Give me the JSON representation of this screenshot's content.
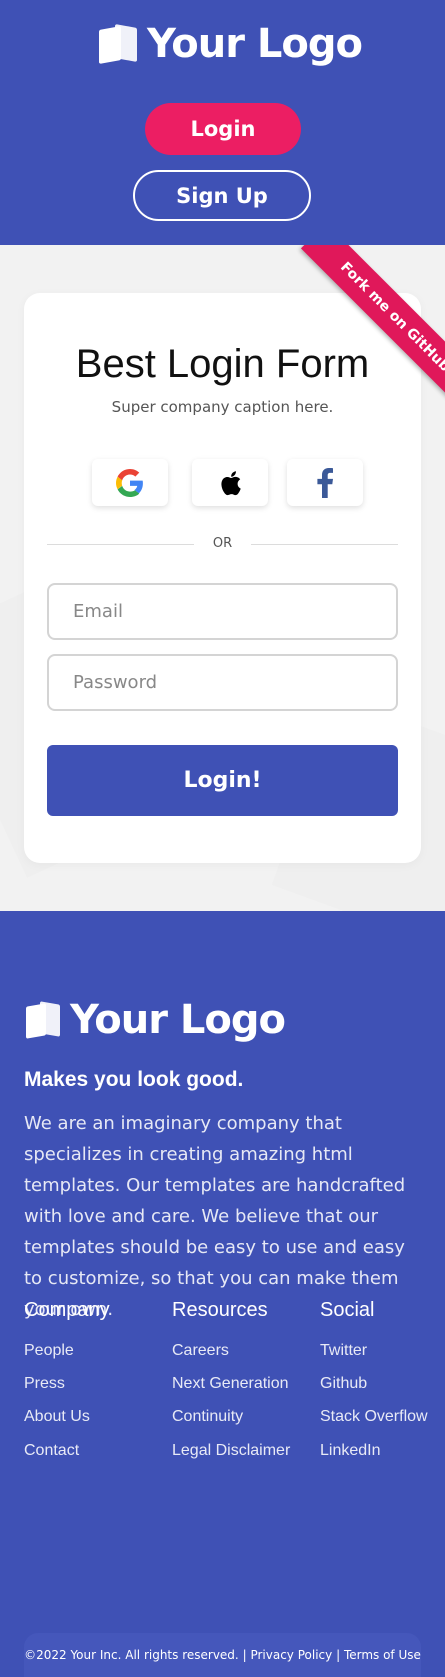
{
  "brand": {
    "logo_text": "Your Logo",
    "primary_color": "#3f51b5",
    "accent_color": "#ec1e63"
  },
  "header": {
    "login_label": "Login",
    "signup_label": "Sign Up"
  },
  "ribbon": {
    "label": "Fork me on GitHub"
  },
  "form": {
    "title": "Best Login Form",
    "caption": "Super company caption here.",
    "social_buttons": [
      {
        "icon": "google-icon"
      },
      {
        "icon": "apple-icon"
      },
      {
        "icon": "facebook-icon"
      }
    ],
    "divider_text": "OR",
    "email_placeholder": "Email",
    "password_placeholder": "Password",
    "submit_label": "Login!"
  },
  "footer": {
    "logo_text": "Your Logo",
    "tagline": "Makes you look good.",
    "about": "We are an imaginary company that specializes in creating amazing html templates. Our templates are handcrafted with love and care. We believe that our templates should be easy to use and easy to customize, so that you can make them your own.",
    "columns": [
      {
        "title": "Company",
        "links": [
          "People",
          "Press",
          "About Us",
          "Contact"
        ]
      },
      {
        "title": "Resources",
        "links": [
          "Careers",
          "Next Generation",
          "Continuity",
          "Legal Disclaimer"
        ]
      },
      {
        "title": "Social",
        "links": [
          "Twitter",
          "Github",
          "Stack Overflow",
          "LinkedIn"
        ]
      }
    ],
    "copyright": "©2022 Your Inc. All rights reserved.",
    "separator": "|",
    "privacy_label": "Privacy Policy",
    "terms_label": "Terms of Use"
  }
}
